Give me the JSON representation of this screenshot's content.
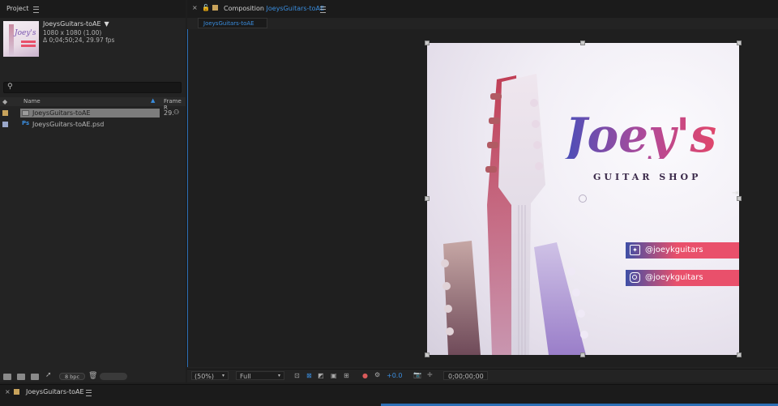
{
  "project": {
    "tab_label": "Project",
    "comp_name": "JoeysGuitars-toAE",
    "comp_size": "1080 x 1080 (1.00)",
    "comp_duration": "Δ 0;04;50;24, 29.97 fps",
    "search_placeholder": "",
    "columns": {
      "name": "Name",
      "frame": "Frame R"
    },
    "items": [
      {
        "name": "JoeysGuitars-toAE",
        "frame": "29.",
        "type": "comp",
        "selected": true
      },
      {
        "name": "JoeysGuitars-toAE.psd",
        "frame": "",
        "type": "psd",
        "selected": false
      }
    ],
    "footer": {
      "bpc": "8 bpc"
    }
  },
  "composition": {
    "tab_prefix": "Composition",
    "tab_name": "JoeysGuitars-toAE",
    "subtab": "JoeysGuitars-toAE",
    "toolbar": {
      "zoom": "(50%)",
      "resolution": "Full",
      "exposure": "+0.0",
      "timecode": "0;00;00;00"
    }
  },
  "artwork": {
    "title": "Joey's",
    "subtitle": "GUITAR SHOP",
    "twitter": "@joeykguitars",
    "instagram": "@joeykguitars",
    "colors": {
      "title_start": "#4b4fb8",
      "title_end": "#e0466a",
      "bar": "#e9506b"
    }
  },
  "timeline": {
    "tab_label": "JoeysGuitars-toAE"
  },
  "colors": {
    "accent": "#3a8dde",
    "panel": "#232323"
  }
}
